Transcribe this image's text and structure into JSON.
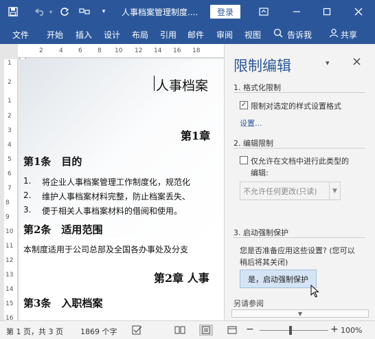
{
  "titlebar": {
    "doc_title": "人事档案管理制度....",
    "login_label": "登录",
    "colors": {
      "accent": "#2b579a"
    }
  },
  "icons": {
    "save": "save-icon",
    "undo": "undo-icon",
    "redo": "redo-icon",
    "touch": "touch-mode-icon",
    "customize": "customize-qat-icon",
    "ribbon_display": "ribbon-display-icon",
    "minimize": "minimize-icon",
    "maximize": "maximize-icon",
    "close": "close-icon",
    "tell_me": "lightbulb-icon",
    "share": "person-icon"
  },
  "ribbon": {
    "tabs": [
      "文件",
      "开始",
      "插入",
      "设计",
      "布局",
      "引用",
      "邮件",
      "审阅",
      "视图"
    ],
    "tell_me": "告诉我",
    "share": "共享"
  },
  "ruler": {
    "h_ticks": [
      "2",
      "4",
      "6",
      "8",
      "10",
      "12",
      "14",
      "16",
      "18"
    ],
    "v_ticks": [
      "1",
      "2",
      "1",
      "2",
      "3",
      "4",
      "5",
      "6",
      "7",
      "8",
      "9",
      "10",
      "11",
      "12",
      "13",
      "14",
      "15",
      "16"
    ]
  },
  "document": {
    "heading": "人事档案",
    "chapter1": "第1章",
    "article1": "第1条　目的",
    "items": [
      {
        "num": "1.",
        "text": "将企业人事档案管理工作制度化，规范化"
      },
      {
        "num": "2.",
        "text": "维护人事档案材料完整，防止档案丢失、"
      },
      {
        "num": "3.",
        "text": "便于相关人事档案材料的借阅和使用。"
      }
    ],
    "article2": "第2条　适用范围",
    "scope": "本制度适用于公司总部及全国各办事处及分支",
    "chapter2": "第2章  人事",
    "article3": "第3条　入职档案"
  },
  "pane": {
    "title": "限制编辑",
    "sec1_title": "1. 格式化限制",
    "sec1_checkbox": "限制对选定的样式设置格式",
    "sec1_checked": true,
    "settings_link": "设置...",
    "sec2_title": "2. 编辑限制",
    "sec2_checkbox_line1": "仅允许在文档中进行此类型的",
    "sec2_checkbox_line2": "编辑:",
    "sec2_checked": false,
    "select_value": "不允许任何更改(只读)",
    "sec3_title": "3. 启动强制保护",
    "sec3_question_line1": "您是否准备应用这些设置? (您可以",
    "sec3_question_line2": "稍后将其关闭)",
    "enforce_button": "是，启动强制保护",
    "see_also": "另请参阅"
  },
  "status": {
    "page": "第 1 页，共 3 页",
    "words": "1869 个字",
    "zoom": "100%",
    "zoom_level_percent": 100
  }
}
